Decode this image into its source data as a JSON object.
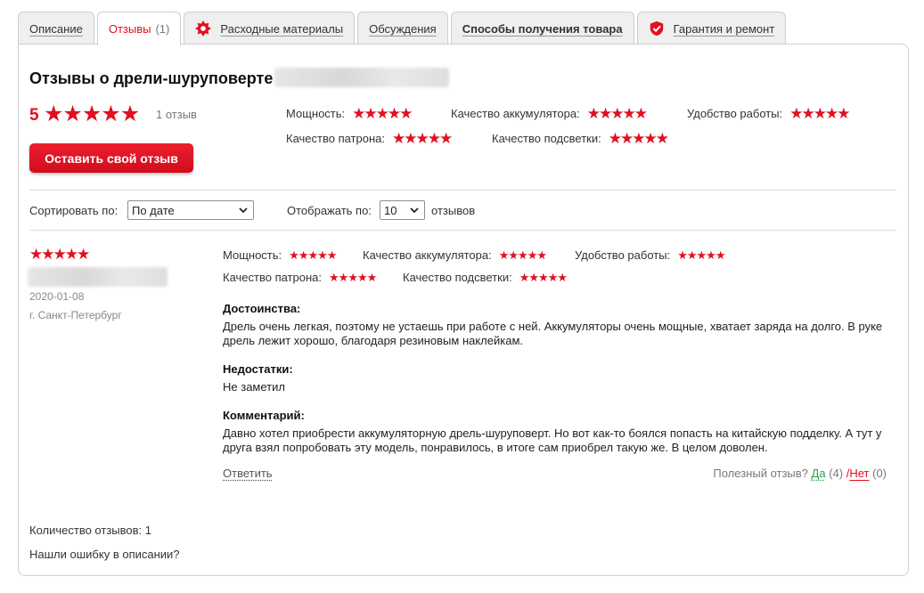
{
  "tabs": [
    {
      "label": "Описание"
    },
    {
      "label": "Отзывы",
      "count": "(1)"
    },
    {
      "label": "Расходные материалы",
      "icon": "saw-blade-icon"
    },
    {
      "label": "Обсуждения"
    },
    {
      "label": "Способы получения товара"
    },
    {
      "label": "Гарантия и ремонт",
      "icon": "shield-check-icon"
    }
  ],
  "summary": {
    "title": "Отзывы о дрели-шуруповерте",
    "rating": "5",
    "stars": 5,
    "count_text": "1 отзыв",
    "leave_review_label": "Оставить свой отзыв",
    "criteria": [
      {
        "name": "Мощность:",
        "stars": 5
      },
      {
        "name": "Качество аккумулятора:",
        "stars": 5
      },
      {
        "name": "Удобство работы:",
        "stars": 5
      },
      {
        "name": "Качество патрона:",
        "stars": 5
      },
      {
        "name": "Качество подсветки:",
        "stars": 5
      }
    ]
  },
  "controls": {
    "sort_label": "Сортировать по:",
    "sort_value": "По дате",
    "display_label": "Отображать по:",
    "display_value": "10",
    "display_suffix": "отзывов"
  },
  "review": {
    "stars": 5,
    "date": "2020-01-08",
    "city": "г. Санкт-Петербург",
    "criteria": [
      {
        "name": "Мощность:",
        "stars": 5
      },
      {
        "name": "Качество аккумулятора:",
        "stars": 5
      },
      {
        "name": "Удобство работы:",
        "stars": 5
      },
      {
        "name": "Качество патрона:",
        "stars": 5
      },
      {
        "name": "Качество подсветки:",
        "stars": 5
      }
    ],
    "pros_title": "Достоинства:",
    "pros_text": "Дрель очень легкая, поэтому не устаешь при работе с ней. Аккумуляторы очень мощные, хватает заряда на долго. В руке дрель лежит хорошо, благодаря резиновым наклейкам.",
    "cons_title": "Недостатки:",
    "cons_text": "Не заметил",
    "comment_title": "Комментарий:",
    "comment_text": "Давно хотел приобрести аккумуляторную дрель-шуруповерт. Но вот как-то боялся попасть на китайскую подделку. А тут у друга взял попробовать эту модель, понравилось, в итоге сам приобрел такую же. В целом доволен.",
    "reply_label": "Ответить",
    "useful_label": "Полезный отзыв?",
    "yes_label": "Да",
    "yes_count": "(4)",
    "slash": "/",
    "no_label": "Нет",
    "no_count": "(0)"
  },
  "footer": {
    "count_text": "Количество отзывов: 1",
    "error_link": "Нашли ошибку в описании?"
  },
  "colors": {
    "accent": "#e20f1f",
    "yes": "#2aa14a"
  }
}
